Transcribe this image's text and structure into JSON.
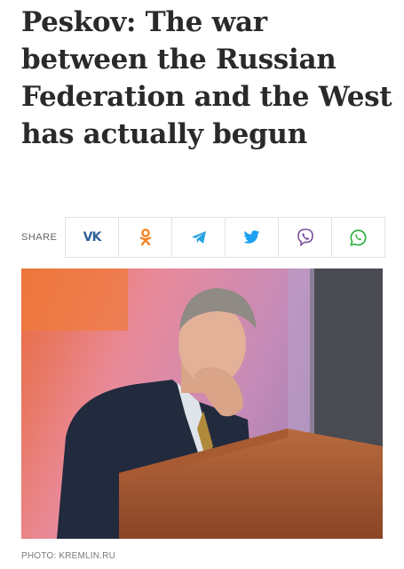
{
  "article": {
    "headline": "Peskov: The war between the Russian Federation and the West has actually begun"
  },
  "share": {
    "label": "SHARE",
    "buttons": [
      {
        "network": "vkontakte",
        "icon": "vk-icon",
        "glyph": "VK",
        "color": "#2f5f98"
      },
      {
        "network": "odnoklassniki",
        "icon": "odnoklassniki-icon",
        "color": "#f58220"
      },
      {
        "network": "telegram",
        "icon": "telegram-icon",
        "color": "#2aa3df"
      },
      {
        "network": "twitter",
        "icon": "twitter-icon",
        "color": "#1da1f2"
      },
      {
        "network": "viber",
        "icon": "viber-icon",
        "color": "#7b519d"
      },
      {
        "network": "whatsapp",
        "icon": "whatsapp-icon",
        "color": "#2fb544"
      }
    ]
  },
  "photo": {
    "credit": "PHOTO: KREMLIN.RU"
  }
}
